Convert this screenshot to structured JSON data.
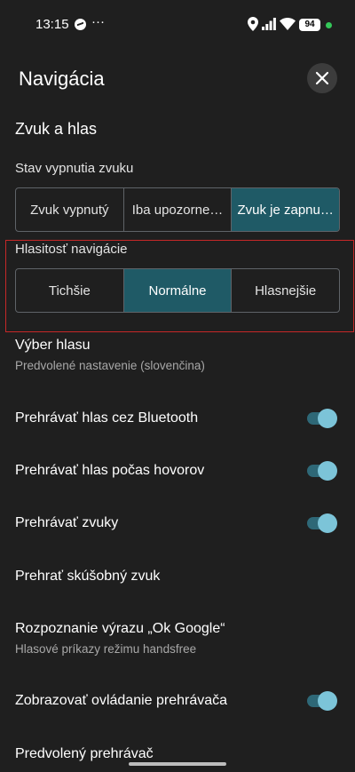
{
  "status_bar": {
    "time": "13:15",
    "icons": [
      "messenger-icon",
      "more-dots-icon",
      "location-icon",
      "signal-icon",
      "wifi-icon",
      "battery-icon"
    ],
    "more": "···",
    "battery": "94"
  },
  "header": {
    "title": "Navigácia",
    "close_icon": "close-icon"
  },
  "section": {
    "title": "Zvuk a hlas"
  },
  "mute_state": {
    "label": "Stav vypnutia zvuku",
    "options": [
      "Zvuk vypnutý",
      "Iba upozorne…",
      "Zvuk je zapnu…"
    ],
    "selected": "Zvuk je zapnu…"
  },
  "nav_volume": {
    "label": "Hlasitosť navigácie",
    "options": [
      "Tichšie",
      "Normálne",
      "Hlasnejšie"
    ],
    "selected": "Normálne"
  },
  "voice_selection": {
    "title": "Výber hlasu",
    "subtitle": "Predvolené nastavenie (slovenčina)"
  },
  "toggles": {
    "bluetooth": {
      "label": "Prehrávať hlas cez Bluetooth",
      "on": true
    },
    "during_calls": {
      "label": "Prehrávať hlas počas hovorov",
      "on": true
    },
    "sounds": {
      "label": "Prehrávať zvuky",
      "on": true
    },
    "player_controls": {
      "label": "Zobrazovať ovládanie prehrávača",
      "on": true
    }
  },
  "test_sound": {
    "title": "Prehrať skúšobný zvuk"
  },
  "ok_google": {
    "title": "Rozpoznanie výrazu „Ok Google“",
    "subtitle": "Hlasové príkazy režimu handsfree"
  },
  "default_player": {
    "title": "Predvolený prehrávač"
  },
  "colors": {
    "background": "#1f1f1f",
    "accent_selected": "#1f5a66",
    "toggle_thumb": "#7cc4d8",
    "highlight_border": "#c62828"
  }
}
